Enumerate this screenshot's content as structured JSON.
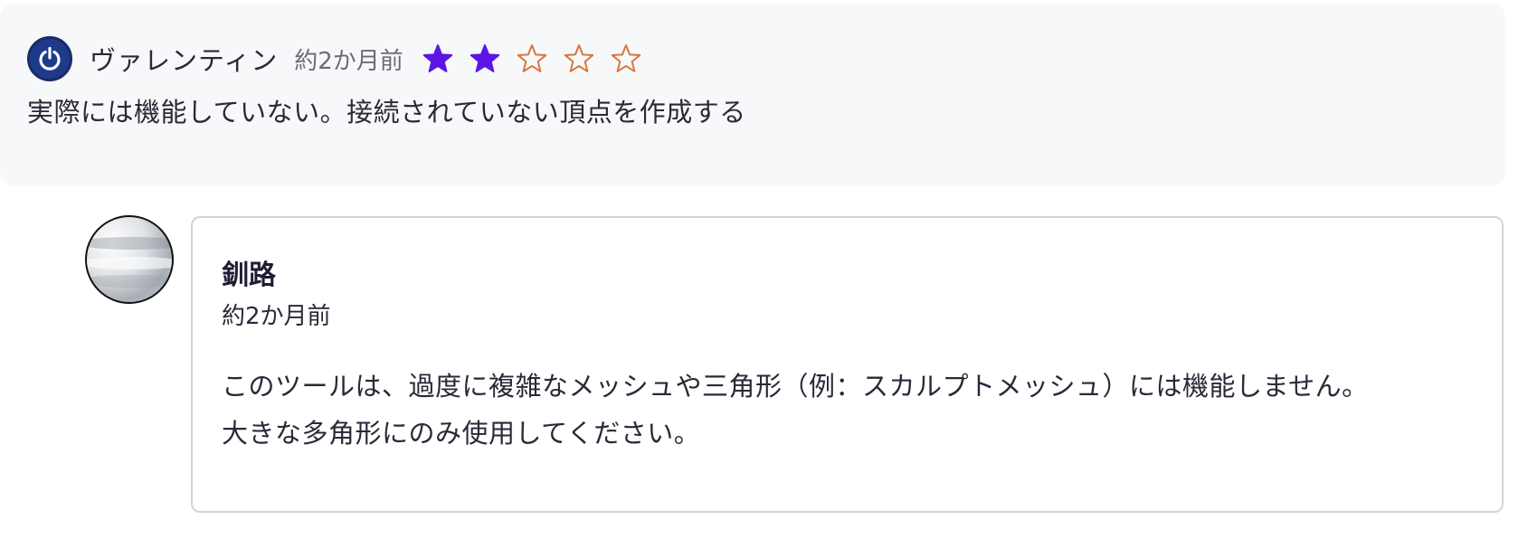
{
  "review": {
    "reviewer_name": "ヴァレンティン",
    "time": "約2か月前",
    "rating": 2,
    "max_rating": 5,
    "text": "実際には機能していない。接続されていない頂点を作成する",
    "avatar_icon": "power-icon"
  },
  "reply": {
    "author": "釧路",
    "time": "約2か月前",
    "body_line1": "このツールは、過度に複雑なメッシュや三角形（例：スカルプトメッシュ）には機能しません。",
    "body_line2": "大きな多角形にのみ使用してください。"
  },
  "colors": {
    "star_filled": "#5b16e5",
    "star_empty_stroke": "#d9773d",
    "card_bg": "#f7f8fa",
    "reply_border": "#d4d4d8"
  }
}
